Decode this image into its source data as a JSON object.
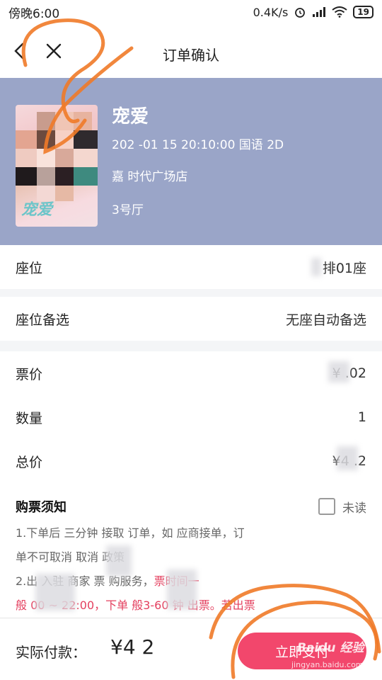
{
  "status_bar": {
    "time": "傍晚6:00",
    "speed": "0.4K/s",
    "battery": "19"
  },
  "nav": {
    "title": "订单确认"
  },
  "movie": {
    "poster_title": "宠爱",
    "title": "宠爱",
    "datetime": "202 -01 15 20:10:00 国语 2D",
    "cinema": "嘉 时代广场店",
    "hall": "3号厅"
  },
  "rows": {
    "seat_label": "座位",
    "seat_value": "排01座",
    "alt_label": "座位备选",
    "alt_value": "无座自动备选",
    "price_label": "票价",
    "price_value": "¥ .02",
    "qty_label": "数量",
    "qty_value": "1",
    "total_label": "总价",
    "total_value": "¥4 .2"
  },
  "notice": {
    "title": "购票须知",
    "unread_label": "未读",
    "line1": "1.下单后 三分钟 接取 订单，如 应商接单，订",
    "line2": "单不可取消 取消 政策",
    "line3a": "2.出 入驻 商家 票 购服务，",
    "line3b": "票时间一",
    "line4": "般 00 ~ 22:00，下单 般3-60 钟 出票。若出票"
  },
  "bottom": {
    "pay_label": "实际付款：",
    "pay_amount": "¥4  2",
    "pay_button": "立即支付"
  },
  "watermark": {
    "text": "Baidu 经验",
    "url_text": "jingyan.baidu.com"
  },
  "colors": {
    "header_bg": "#9aa5c8",
    "accent": "#f2476c",
    "annotation": "#f07a28"
  }
}
